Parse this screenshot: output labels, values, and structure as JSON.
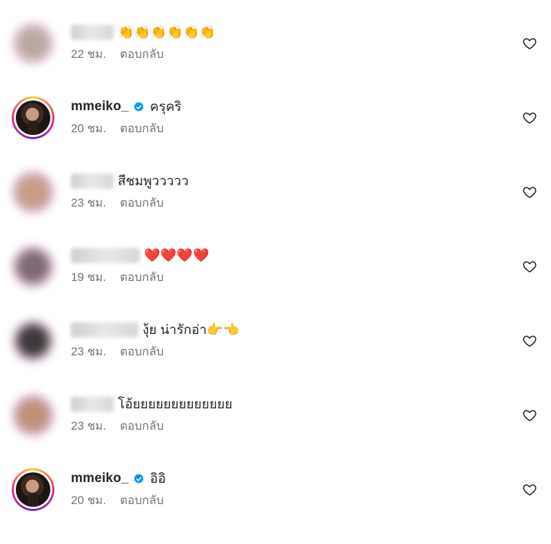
{
  "comments": [
    {
      "avatar_color": "#e4c6d8",
      "verified": false,
      "username": "",
      "text": "👏👏👏👏👏👏",
      "time": "22 ชม.",
      "reply": "ตอบกลับ",
      "blurred": true
    },
    {
      "avatar_color": "#3b2a22",
      "verified": true,
      "username": "mmeiko_",
      "text": "ครุคริ",
      "time": "20 ชม.",
      "reply": "ตอบกลับ",
      "blurred": false
    },
    {
      "avatar_color": "#b78a78",
      "verified": false,
      "username": "",
      "text": "สีชมพูววววว",
      "time": "23 ชม.",
      "reply": "ตอบกลับ",
      "blurred": true
    },
    {
      "avatar_color": "#8a6b78",
      "verified": false,
      "username": "",
      "text": "❤️❤️❤️❤️",
      "time": "19 ชม.",
      "reply": "ตอบกลับ",
      "blurred": true
    },
    {
      "avatar_color": "#4a4548",
      "verified": false,
      "username": "",
      "text": "งุ้ย น่ารักอ่า👉👈",
      "time": "23 ชม.",
      "reply": "ตอบกลับ",
      "blurred": true
    },
    {
      "avatar_color": "#b48274",
      "verified": false,
      "username": "",
      "text": "โอ้ยยยยยยยยยยยยย",
      "time": "23 ชม.",
      "reply": "ตอบกลับ",
      "blurred": true
    },
    {
      "avatar_color": "#3b2a22",
      "verified": true,
      "username": "mmeiko_",
      "text": "อิอิ",
      "time": "20 ชม.",
      "reply": "ตอบกลับ",
      "blurred": false
    }
  ],
  "icons": {
    "like": "heart-outline-icon",
    "verified": "verified-badge-icon"
  },
  "colors": {
    "text": "#262626",
    "meta": "#737373",
    "verified": "#0095f6"
  }
}
